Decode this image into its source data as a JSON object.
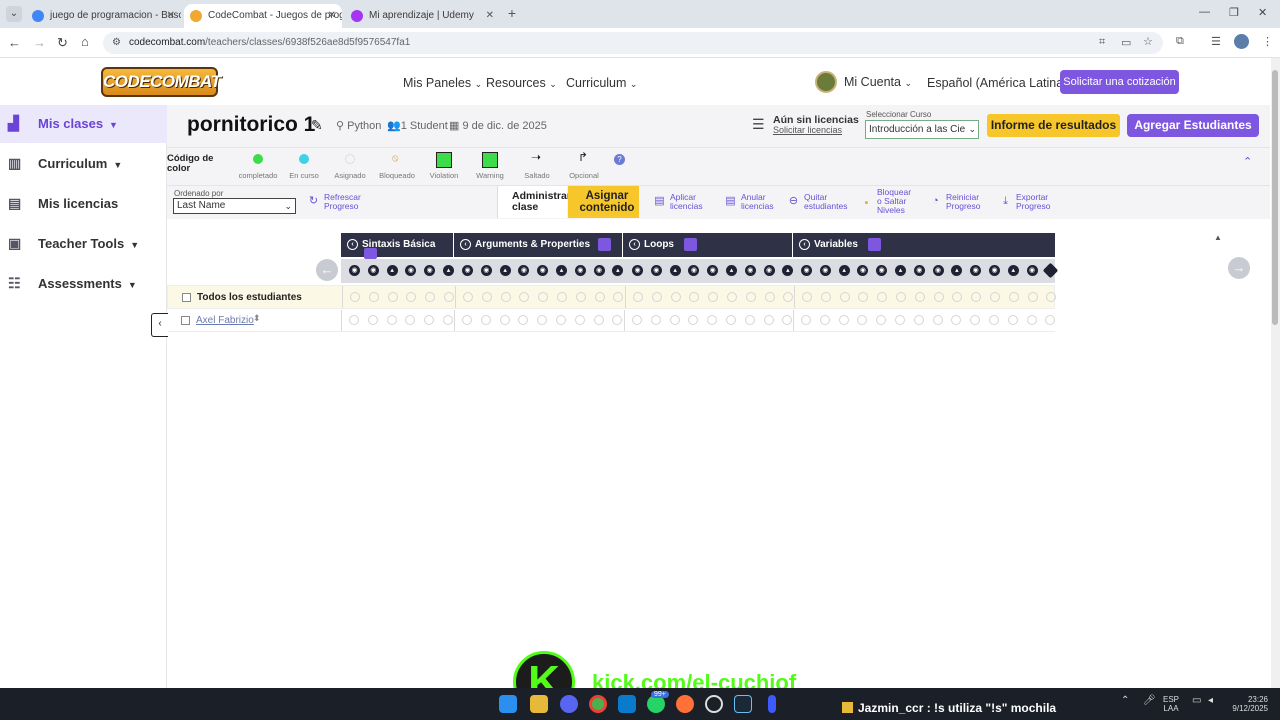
{
  "browser": {
    "tabs": [
      {
        "title": "juego de programacion - Busca",
        "favicon_color": "#4285f4"
      },
      {
        "title": "CodeCombat - Juegos de prog",
        "favicon_color": "#f0a830"
      },
      {
        "title": "Mi aprendizaje | Udemy",
        "favicon_color": "#a435f0"
      }
    ],
    "url_domain": "codecombat.com",
    "url_path": "/teachers/classes/6938f526ae8d5f9576547fa1"
  },
  "topnav": {
    "logo": "CODECOMBAT",
    "links": [
      "Mis Paneles",
      "Resources",
      "Curriculum"
    ],
    "account": "Mi Cuenta",
    "language": "Español (América Latina)",
    "quote_button": "Solicitar una cotización"
  },
  "sidebar": {
    "items": [
      {
        "label": "Mis clases",
        "icon": "chart-icon",
        "caret": true
      },
      {
        "label": "Curriculum",
        "icon": "books-icon",
        "caret": true
      },
      {
        "label": "Mis licencias",
        "icon": "license-icon",
        "caret": false
      },
      {
        "label": "Teacher Tools",
        "icon": "toolbox-icon",
        "caret": true
      },
      {
        "label": "Assessments",
        "icon": "checklist-icon",
        "caret": true
      }
    ]
  },
  "classinfo": {
    "title": "pornitorico 1",
    "language": "Python",
    "students": "1 Student",
    "date": "9 de dic. de 2025",
    "license_status": "Aún sin licencias",
    "license_link": "Solicitar licencias",
    "course_label": "Seleccionar Curso",
    "course_value": "Introducción a las Cie",
    "report_button": "Informe de resultados",
    "add_students_button": "Agregar Estudiantes"
  },
  "legend": {
    "title": "Código de color",
    "items": [
      {
        "label": "completado",
        "color": "#3ddc4a"
      },
      {
        "label": "En curso",
        "color": "#3dd3e6"
      },
      {
        "label": "Asignado",
        "color": "#e4e4e4"
      },
      {
        "label": "Bloqueado",
        "color": "#e6c040"
      },
      {
        "label": "Violation",
        "color": "#3ddc4a"
      },
      {
        "label": "Warning",
        "color": "#3ddc4a"
      },
      {
        "label": "Saltado",
        "color": "#222222"
      },
      {
        "label": "Opcional",
        "color": "#222222"
      }
    ]
  },
  "toolbar": {
    "sort_label": "Ordenado por",
    "sort_value": "Last Name",
    "refresh": "Refrescar Progreso",
    "manage_tab": "Administrar clase",
    "assign_tab": "Asignar contenido",
    "actions": [
      "Aplicar licencias",
      "Anular licencias",
      "Quitar estudiantes",
      "Bloquear o Saltar Niveles",
      "Reiniciar Progreso",
      "Exportar Progreso"
    ]
  },
  "grid": {
    "modules": [
      {
        "name": "Sintaxis Básica"
      },
      {
        "name": "Arguments & Properties"
      },
      {
        "name": "Loops"
      },
      {
        "name": "Variables"
      }
    ],
    "all_students_label": "Todos los estudiantes",
    "students": [
      {
        "name": "Axel Fabrizio"
      }
    ]
  },
  "stream": {
    "kick_letter": "K",
    "kick_url": "kick.com/el-cuchiof",
    "chat": "Jazmin_ccr : !s utiliza \"!s\" mochila"
  },
  "taskbar": {
    "lang": "ESP",
    "region": "LAA",
    "time": "23:26",
    "date": "9/12/2025",
    "badge": "99+"
  }
}
